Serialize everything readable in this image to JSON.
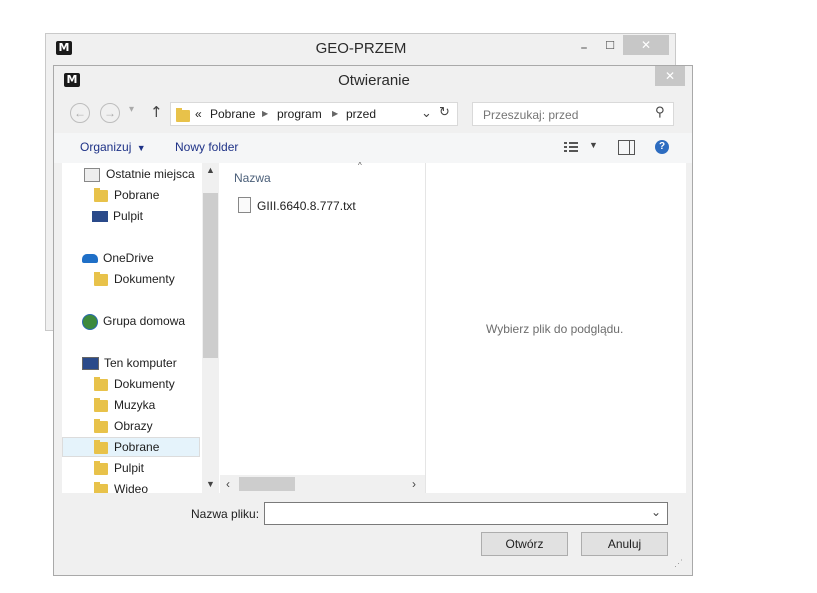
{
  "background_window": {
    "title": "GEO-PRZEM",
    "minimize": "–",
    "maximize": "☐",
    "close": "✕"
  },
  "dialog": {
    "title": "Otwieranie",
    "close": "✕"
  },
  "navigation": {
    "back": "←",
    "forward": "→",
    "recent": "▾",
    "up": "↑",
    "path_prefix": "«",
    "path": [
      "Pobrane",
      "program",
      "przed"
    ],
    "dropdown": "⌄",
    "refresh": "↻",
    "search_placeholder": "Przeszukaj: przed",
    "search_icon": "⚲"
  },
  "toolbar": {
    "organize": "Organizuj",
    "new_folder": "Nowy folder",
    "view_icon": "view-list-icon",
    "preview_pane_icon": "preview-pane-icon",
    "help_icon": "help-icon"
  },
  "sidebar": {
    "items": [
      {
        "label": "Ostatnie miejsca",
        "icon": "recent-places-icon"
      },
      {
        "label": "Pobrane",
        "icon": "downloads-folder-icon"
      },
      {
        "label": "Pulpit",
        "icon": "desktop-icon"
      },
      {
        "label": "OneDrive",
        "icon": "onedrive-icon"
      },
      {
        "label": "Dokumenty",
        "icon": "folder-icon"
      },
      {
        "label": "Grupa domowa",
        "icon": "homegroup-icon"
      },
      {
        "label": "Ten komputer",
        "icon": "computer-icon"
      },
      {
        "label": "Dokumenty",
        "icon": "documents-folder-icon"
      },
      {
        "label": "Muzyka",
        "icon": "music-folder-icon"
      },
      {
        "label": "Obrazy",
        "icon": "pictures-folder-icon"
      },
      {
        "label": "Pobrane",
        "icon": "downloads-folder-icon"
      },
      {
        "label": "Pulpit",
        "icon": "desktop-folder-icon"
      },
      {
        "label": "Wideo",
        "icon": "videos-folder-icon"
      }
    ],
    "selected_index": 10
  },
  "file_list": {
    "column_header": "Nazwa",
    "files": [
      {
        "name": "GIII.6640.8.777.txt",
        "icon": "text-file-icon"
      }
    ]
  },
  "preview": {
    "message": "Wybierz plik do podglądu."
  },
  "footer": {
    "filename_label": "Nazwa pliku:",
    "filename_value": "",
    "open_button": "Otwórz",
    "cancel_button": "Anuluj"
  }
}
